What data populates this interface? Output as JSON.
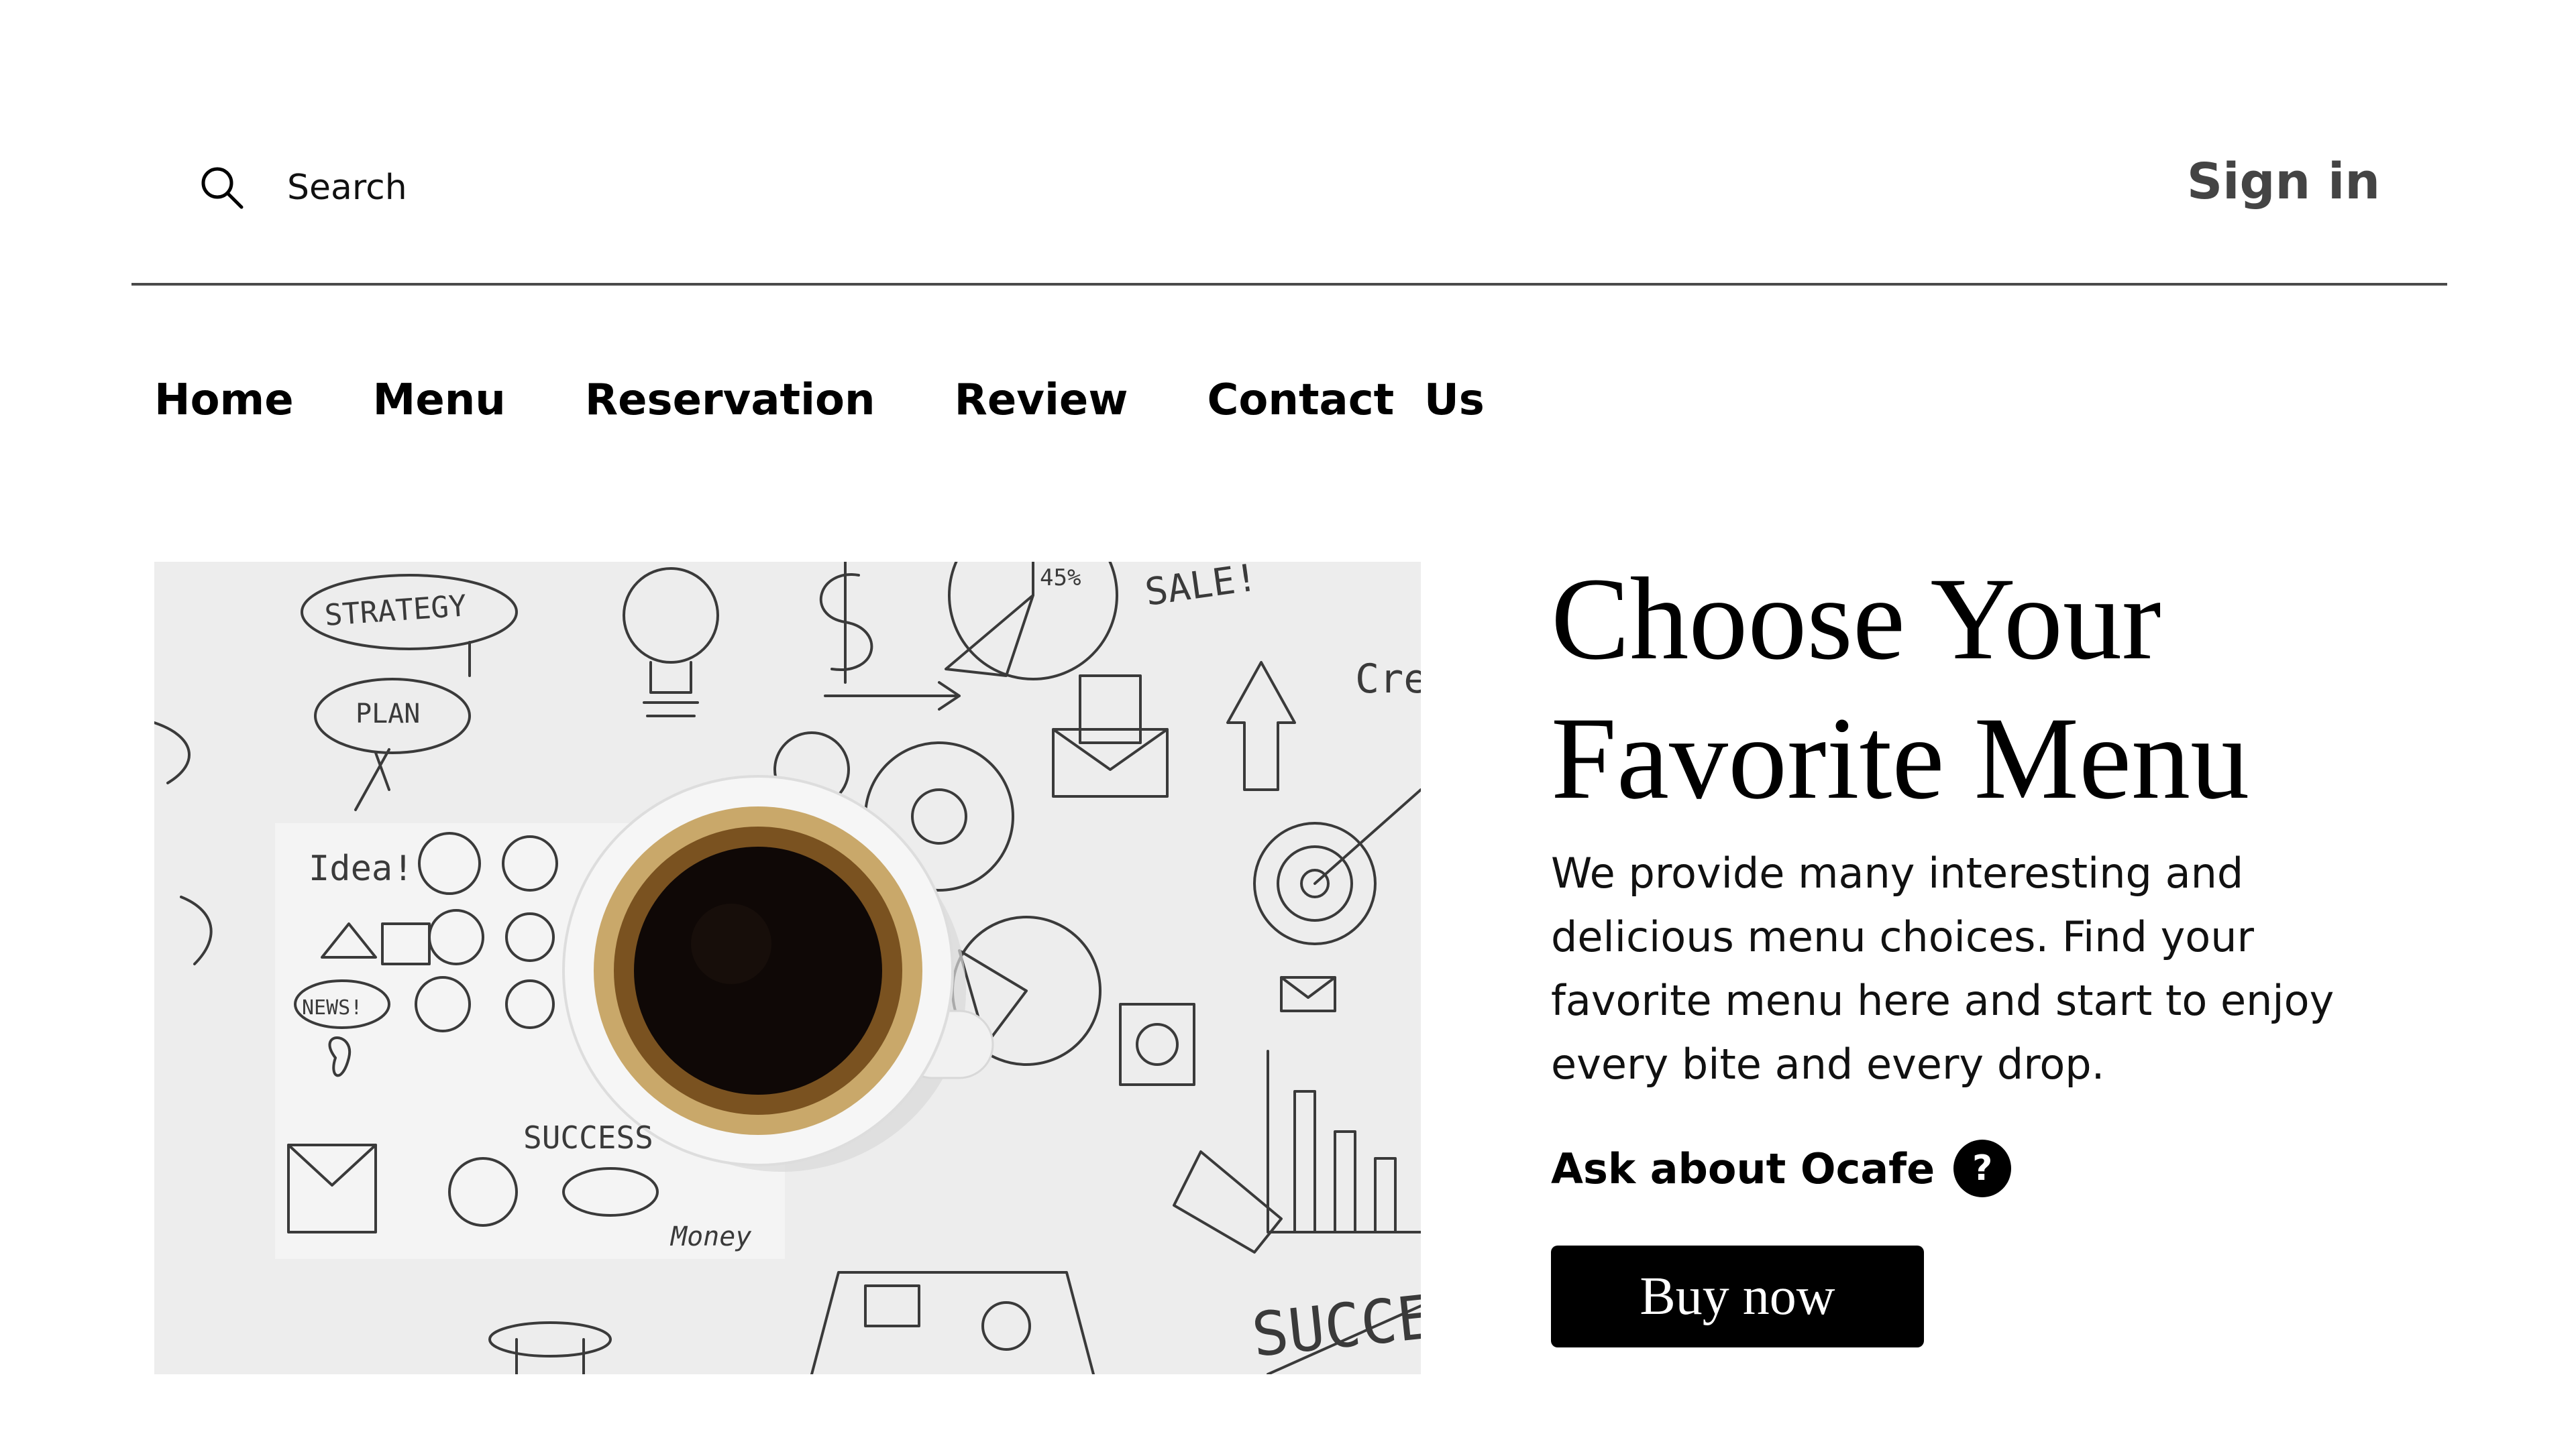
{
  "header": {
    "search_placeholder": "Search",
    "signin_label": "Sign in"
  },
  "nav": {
    "items": [
      {
        "label": "Home"
      },
      {
        "label": "Menu"
      },
      {
        "label": "Reservation"
      },
      {
        "label": "Review"
      },
      {
        "label": "Contact  Us"
      }
    ]
  },
  "hero": {
    "image_alt": "coffee-cup-on-doodle-background",
    "title_line1": "Choose Your",
    "title_line2": "Favorite Menu",
    "description": "We provide many interesting and delicious menu choices. Find your favorite menu here and start to enjoy every bite and every drop.",
    "ask_label": "Ask about Ocafe",
    "help_glyph": "?",
    "buy_label": "Buy now",
    "doodle_words": [
      "STRATEGY",
      "PLAN",
      "SALE!",
      "45%",
      "Idea!",
      "NEWS!",
      "SUCCESS",
      "Money",
      "SUCCE",
      "Cre"
    ]
  },
  "colors": {
    "background": "#ffffff",
    "text": "#000000",
    "signin": "#444444",
    "divider": "#4a4a4a",
    "button_bg": "#000000",
    "button_text": "#ffffff"
  },
  "icons": {
    "search": "search-icon",
    "help": "question-circle-icon"
  }
}
